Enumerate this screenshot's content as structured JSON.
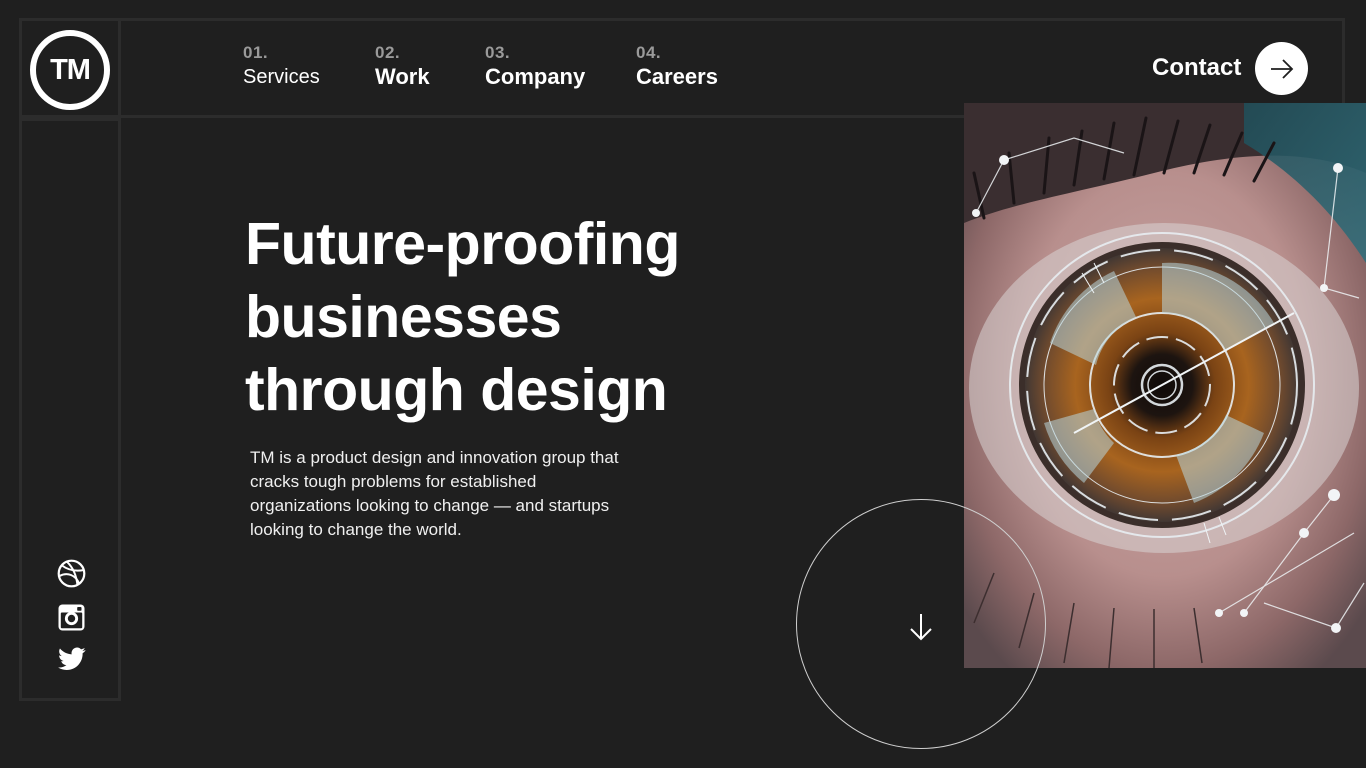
{
  "logo": {
    "text": "TM"
  },
  "nav": {
    "items": [
      {
        "num": "01.",
        "label": "Services"
      },
      {
        "num": "02.",
        "label": "Work"
      },
      {
        "num": "03.",
        "label": "Company"
      },
      {
        "num": "04.",
        "label": "Careers"
      }
    ]
  },
  "contact": {
    "label": "Contact",
    "icon": "arrow-right-icon"
  },
  "hero": {
    "title_lines": [
      "Future-proofing",
      "businesses",
      "through design"
    ],
    "description": "TM is a product design and innovation group that cracks tough problems for established organizations looking to change — and startups looking to change the world."
  },
  "social": [
    "dribbble-icon",
    "instagram-icon",
    "twitter-icon"
  ],
  "scroll": {
    "icon": "arrow-down-icon"
  },
  "colors": {
    "background": "#1f1f1f",
    "frame": "#2c2c2c",
    "text": "#ffffff",
    "muted": "#9a9a9a"
  }
}
